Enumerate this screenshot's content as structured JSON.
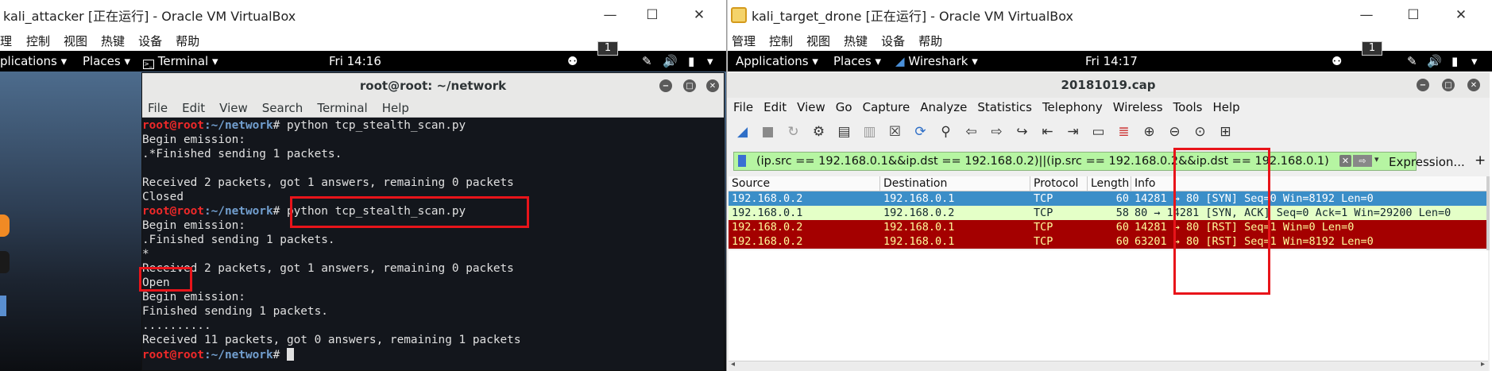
{
  "left_window": {
    "title": "kali_attacker [正在运行] - Oracle VM VirtualBox",
    "menu": [
      "控制",
      "视图",
      "热键",
      "设备",
      "帮助"
    ],
    "menu_cut": "理",
    "topbar": {
      "apps": "plications",
      "places": "Places",
      "terminal": "Terminal",
      "clock": "Fri 14:16",
      "workspace": "1"
    },
    "terminal": {
      "title": "root@root: ~/network",
      "menu": [
        "File",
        "Edit",
        "View",
        "Search",
        "Terminal",
        "Help"
      ],
      "lines": [
        {
          "user": "root@root",
          "path": ":~/network",
          "cmd": "# python tcp_stealth_scan.py"
        },
        {
          "text": "Begin emission:"
        },
        {
          "text": ".*Finished sending 1 packets."
        },
        {
          "text": ""
        },
        {
          "text": "Received 2 packets, got 1 answers, remaining 0 packets"
        },
        {
          "text": "Closed"
        },
        {
          "user": "root@root",
          "path": ":~/network",
          "cmd": "# python tcp_stealth_scan.py"
        },
        {
          "text": "Begin emission:"
        },
        {
          "text": ".Finished sending 1 packets."
        },
        {
          "text": "*"
        },
        {
          "text": "Received 2 packets, got 1 answers, remaining 0 packets"
        },
        {
          "text": "Open"
        },
        {
          "text": "Begin emission:"
        },
        {
          "text": "Finished sending 1 packets."
        },
        {
          "text": ".........."
        },
        {
          "text": "Received 11 packets, got 0 answers, remaining 1 packets"
        },
        {
          "user": "root@root",
          "path": ":~/network",
          "cmd": "# ",
          "cursor": true
        }
      ]
    }
  },
  "right_window": {
    "title": "kali_target_drone [正在运行] - Oracle VM VirtualBox",
    "menu": [
      "管理",
      "控制",
      "视图",
      "热键",
      "设备",
      "帮助"
    ],
    "topbar": {
      "apps": "Applications",
      "places": "Places",
      "app": "Wireshark",
      "clock": "Fri 14:17",
      "workspace": "1"
    },
    "wireshark": {
      "title": "20181019.cap",
      "menu": [
        "File",
        "Edit",
        "View",
        "Go",
        "Capture",
        "Analyze",
        "Statistics",
        "Telephony",
        "Wireless",
        "Tools",
        "Help"
      ],
      "filter": "(ip.src == 192.168.0.1&&ip.dst == 192.168.0.2)||(ip.src == 192.168.0.2&&ip.dst == 192.168.0.1)",
      "expression": "Expression...",
      "plus": "+",
      "columns": [
        "Source",
        "Destination",
        "Protocol",
        "Length",
        "Info"
      ],
      "packets": [
        {
          "src": "192.168.0.2",
          "dst": "192.168.0.1",
          "proto": "TCP",
          "len": "60",
          "info": "14281 → 80 [SYN] Seq=0 Win=8192 Len=0",
          "bg": "#3b8ec8",
          "fg": "#ffffff"
        },
        {
          "src": "192.168.0.1",
          "dst": "192.168.0.2",
          "proto": "TCP",
          "len": "58",
          "info": "80 → 14281 [SYN, ACK] Seq=0 Ack=1 Win=29200 Len=0",
          "bg": "#e4ffc7",
          "fg": "#12272e"
        },
        {
          "src": "192.168.0.2",
          "dst": "192.168.0.1",
          "proto": "TCP",
          "len": "60",
          "info": "14281 → 80 [RST] Seq=1 Win=0 Len=0",
          "bg": "#a40000",
          "fg": "#fffc9c"
        },
        {
          "src": "192.168.0.2",
          "dst": "192.168.0.1",
          "proto": "TCP",
          "len": "60",
          "info": "63201 → 80 [RST] Seq=1 Win=8192 Len=0",
          "bg": "#a40000",
          "fg": "#fffc9c"
        }
      ]
    }
  },
  "colors": {
    "annotation": "#e8141a",
    "prompt_user": "#ef2929",
    "prompt_path": "#729fcf"
  }
}
